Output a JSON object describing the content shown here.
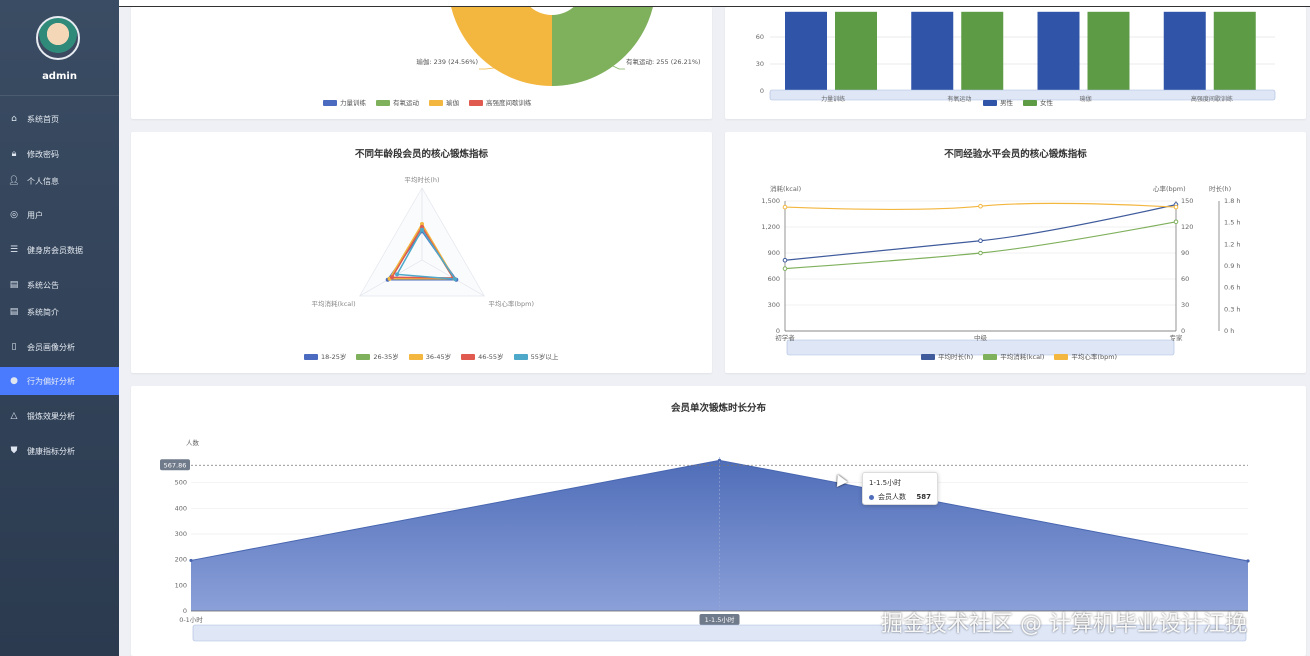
{
  "sidebar": {
    "username": "admin",
    "items": [
      {
        "label": "系统首页",
        "icon": "home-icon",
        "glyph": "⌂"
      },
      {
        "label": "修改密码",
        "icon": "lock-icon",
        "glyph": "🔒︎"
      },
      {
        "label": "个人信息",
        "icon": "user-icon",
        "glyph": "👤︎"
      },
      {
        "label": "用户",
        "icon": "globe-icon",
        "glyph": "◎"
      },
      {
        "label": "健身房会员数据",
        "icon": "sliders-icon",
        "glyph": "☰"
      },
      {
        "label": "系统公告",
        "icon": "clipboard-icon",
        "glyph": "▤"
      },
      {
        "label": "系统简介",
        "icon": "clipboard-icon",
        "glyph": "▤"
      },
      {
        "label": "会员画像分析",
        "icon": "phone-icon",
        "glyph": "▯"
      },
      {
        "label": "行为偏好分析",
        "icon": "location-icon",
        "glyph": "●"
      },
      {
        "label": "锻炼效果分析",
        "icon": "bell-icon",
        "glyph": "△"
      },
      {
        "label": "健康指标分析",
        "icon": "shield-icon",
        "glyph": "⛊"
      }
    ],
    "active_index": 8,
    "active_color": "#4a7bff"
  },
  "pie_card": {
    "labels": {
      "left": "瑜伽: 239 (24.56%)",
      "right": "有氧运动: 255 (26.21%)"
    },
    "legend": [
      "力量训练",
      "有氧运动",
      "瑜伽",
      "高强度间歇训练"
    ]
  },
  "bar_card": {
    "y_ticks": [
      "60",
      "30",
      "0"
    ],
    "categories": [
      "力量训练",
      "有氧运动",
      "瑜伽",
      "高强度间歇训练"
    ],
    "legend": [
      "男性",
      "女性"
    ]
  },
  "radar_card": {
    "title": "不同年龄段会员的核心锻炼指标",
    "indicators": [
      "平均时长(h)",
      "平均消耗(kcal)",
      "平均心率(bpm)"
    ],
    "legend": [
      "18-25岁",
      "26-35岁",
      "36-45岁",
      "46-55岁",
      "55岁以上"
    ]
  },
  "line_card": {
    "title": "不同经验水平会员的核心锻炼指标",
    "left_axis_name": "消耗(kcal)",
    "right_axis_name": "心率(bpm)",
    "right2_axis_name": "时长(h)",
    "left_ticks": [
      "1,500",
      "1,200",
      "900",
      "600",
      "300",
      "0"
    ],
    "right_ticks": [
      "150",
      "120",
      "90",
      "60",
      "30",
      "0"
    ],
    "right2_ticks": [
      "1.8 h",
      "1.5 h",
      "1.2 h",
      "0.9 h",
      "0.6 h",
      "0.3 h",
      "0 h"
    ],
    "x_labels": [
      "初学者",
      "中级",
      "专家"
    ],
    "legend": [
      "平均时长(h)",
      "平均消耗(kcal)",
      "平均心率(bpm)"
    ]
  },
  "area_card": {
    "title": "会员单次锻炼时长分布",
    "y_axis_name": "人数",
    "y_ticks": [
      "500",
      "400",
      "300",
      "200",
      "100",
      "0"
    ],
    "marker_label": "567.86",
    "x_labels": [
      "0-1小时",
      "1-1.5小时"
    ],
    "tooltip": {
      "title": "1-1.5小时",
      "series": "会员人数",
      "value": "587"
    }
  },
  "chart_data": [
    {
      "type": "pie",
      "labels": [
        "瑜伽",
        "有氧运动"
      ],
      "values": [
        239,
        255
      ],
      "percents": [
        24.56,
        26.21
      ],
      "legend": [
        "力量训练",
        "有氧运动",
        "瑜伽",
        "高强度间歇训练"
      ],
      "colors": [
        "#4a6bbf",
        "#7fb05c",
        "#f3b63f",
        "#e05a4f"
      ],
      "legend_position": "bottom"
    },
    {
      "type": "bar",
      "categories": [
        "力量训练",
        "有氧运动",
        "瑜伽",
        "高强度间歇训练"
      ],
      "series": [
        {
          "name": "男性",
          "values": [
            88,
            88,
            88,
            88
          ],
          "color": "#2f54a8"
        },
        {
          "name": "女性",
          "values": [
            88,
            88,
            88,
            88
          ],
          "color": "#5e9b45"
        }
      ],
      "ylim": [
        0,
        90
      ],
      "legend_position": "bottom"
    },
    {
      "type": "radar",
      "title": "不同年龄段会员的核心锻炼指标",
      "indicators": [
        "平均时长(h)",
        "平均消耗(kcal)",
        "平均心率(bpm)"
      ],
      "series": [
        {
          "name": "18-25岁",
          "values": [
            0.4,
            0.55,
            0.55
          ],
          "color": "#4a6bbf"
        },
        {
          "name": "26-35岁",
          "values": [
            0.45,
            0.52,
            0.5
          ],
          "color": "#7fb05c"
        },
        {
          "name": "36-45岁",
          "values": [
            0.5,
            0.52,
            0.52
          ],
          "color": "#f3b63f"
        },
        {
          "name": "46-55岁",
          "values": [
            0.46,
            0.48,
            0.5
          ],
          "color": "#e05a4f"
        },
        {
          "name": "55岁以上",
          "values": [
            0.42,
            0.4,
            0.53
          ],
          "color": "#4da8c9"
        }
      ],
      "legend_position": "bottom"
    },
    {
      "type": "line",
      "title": "不同经验水平会员的核心锻炼指标",
      "x": [
        "初学者",
        "中级",
        "专家"
      ],
      "series": [
        {
          "name": "平均时长(h)",
          "values": [
            0.98,
            1.25,
            1.75
          ],
          "color": "#3f5b9c",
          "axis": "right2",
          "ylim": [
            0,
            1.8
          ]
        },
        {
          "name": "平均消耗(kcal)",
          "values": [
            720,
            900,
            1260
          ],
          "color": "#7fb05c",
          "axis": "left",
          "ylim": [
            0,
            1500
          ]
        },
        {
          "name": "平均心率(bpm)",
          "values": [
            143,
            144,
            143
          ],
          "color": "#f3b63f",
          "axis": "right",
          "ylim": [
            0,
            150
          ]
        }
      ],
      "legend_position": "bottom"
    },
    {
      "type": "area",
      "title": "会员单次锻炼时长分布",
      "ylabel": "人数",
      "x": [
        "0-1小时",
        "1-1.5小时",
        ""
      ],
      "series": [
        {
          "name": "会员人数",
          "values": [
            197,
            587,
            195
          ],
          "color": "#5672b8"
        }
      ],
      "ylim": [
        0,
        600
      ],
      "mark_line": 567.86
    }
  ]
}
